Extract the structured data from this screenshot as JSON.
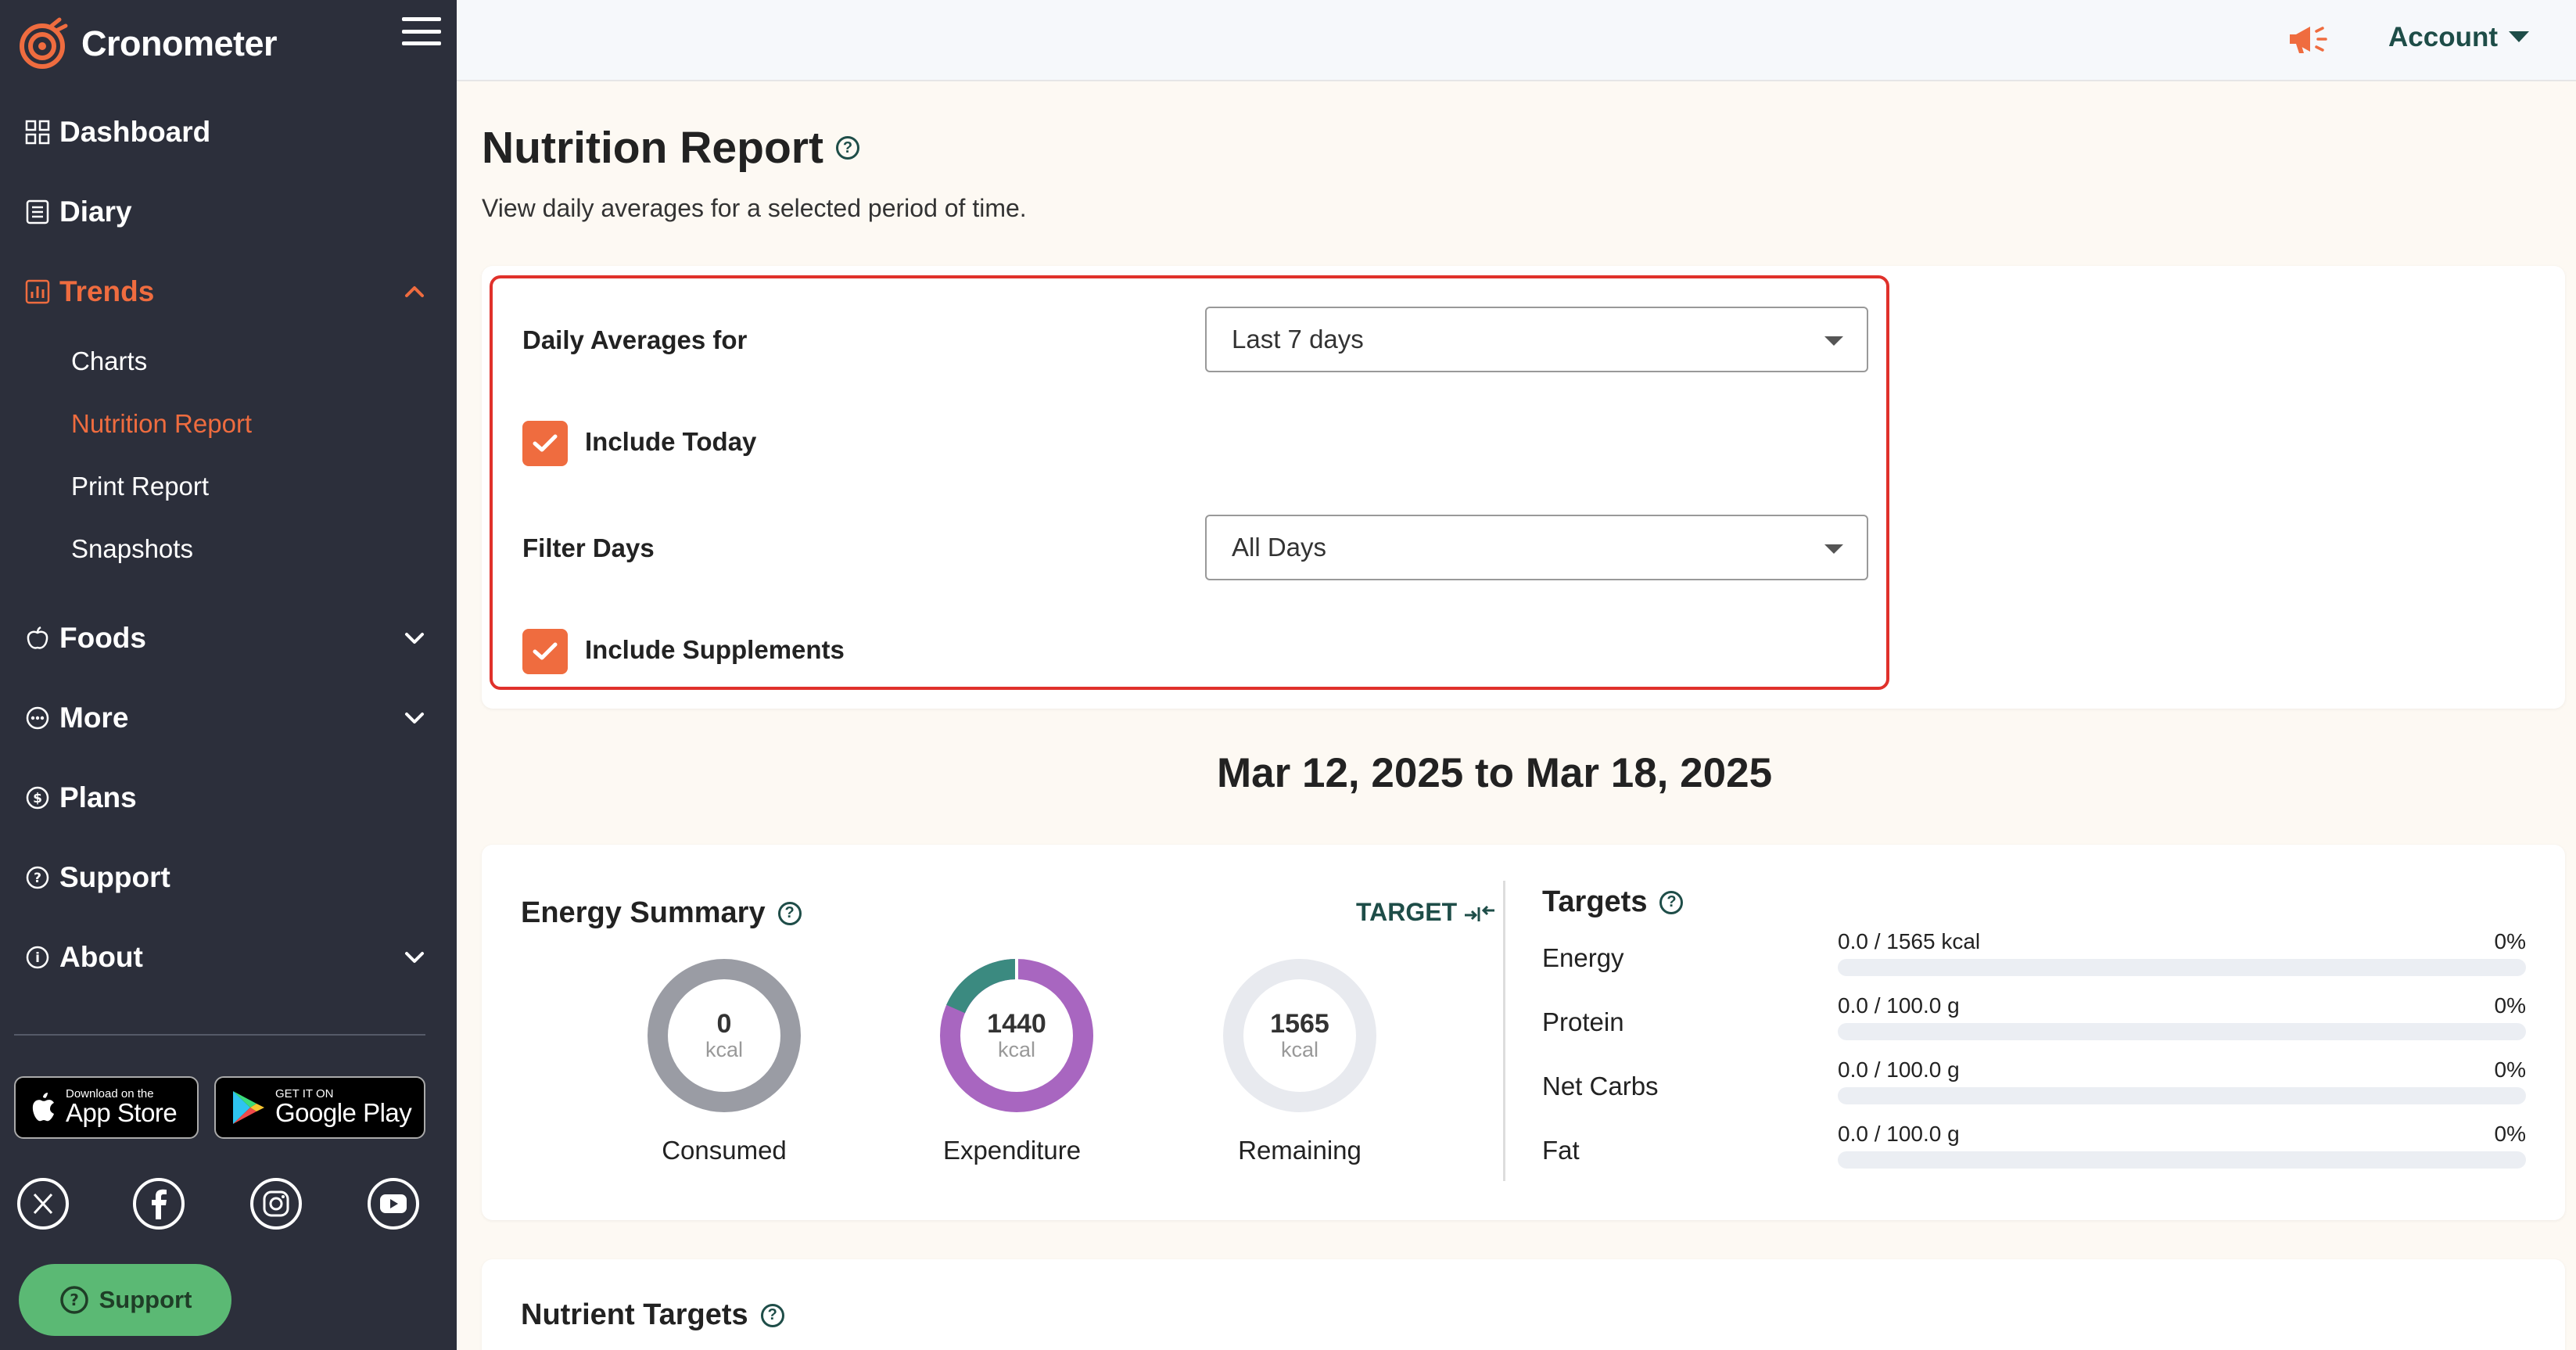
{
  "app": {
    "name": "Cronometer"
  },
  "sidebar": {
    "items": [
      {
        "label": "Dashboard",
        "icon": "grid-icon"
      },
      {
        "label": "Diary",
        "icon": "list-icon"
      },
      {
        "label": "Trends",
        "icon": "chart-icon",
        "expanded": true
      },
      {
        "label": "Foods",
        "icon": "apple-icon"
      },
      {
        "label": "More",
        "icon": "dots-icon"
      },
      {
        "label": "Plans",
        "icon": "dollar-icon"
      },
      {
        "label": "Support",
        "icon": "question-icon"
      },
      {
        "label": "About",
        "icon": "info-icon"
      }
    ],
    "trends_sub": [
      "Charts",
      "Nutrition Report",
      "Print Report",
      "Snapshots"
    ],
    "active_sub": "Nutrition Report",
    "app_store": {
      "small": "Download on the",
      "big": "App Store"
    },
    "google_play": {
      "small": "GET IT ON",
      "big": "Google Play"
    },
    "social": [
      "x-icon",
      "facebook-icon",
      "instagram-icon",
      "youtube-icon"
    ],
    "support_button": "Support"
  },
  "topbar": {
    "account_label": "Account"
  },
  "page": {
    "title": "Nutrition Report",
    "subtitle": "View daily averages for a selected period of time."
  },
  "filters": {
    "daily_averages_label": "Daily Averages for",
    "daily_averages_value": "Last 7 days",
    "include_today_label": "Include Today",
    "include_today": true,
    "filter_days_label": "Filter Days",
    "filter_days_value": "All Days",
    "include_supplements_label": "Include Supplements",
    "include_supplements": true
  },
  "date_range": "Mar 12, 2025 to Mar 18, 2025",
  "energy_summary": {
    "title": "Energy Summary",
    "target_link": "TARGET",
    "rings": [
      {
        "value": "0",
        "unit": "kcal",
        "label": "Consumed"
      },
      {
        "value": "1440",
        "unit": "kcal",
        "label": "Expenditure"
      },
      {
        "value": "1565",
        "unit": "kcal",
        "label": "Remaining"
      }
    ]
  },
  "targets": {
    "title": "Targets",
    "rows": [
      {
        "name": "Energy",
        "value": "0.0 / 1565 kcal",
        "percent": "0%",
        "fill": 0
      },
      {
        "name": "Protein",
        "value": "0.0 / 100.0 g",
        "percent": "0%",
        "fill": 0
      },
      {
        "name": "Net Carbs",
        "value": "0.0 / 100.0 g",
        "percent": "0%",
        "fill": 0
      },
      {
        "name": "Fat",
        "value": "0.0 / 100.0 g",
        "percent": "0%",
        "fill": 0
      }
    ]
  },
  "nutrient_targets": {
    "title": "Nutrient Targets"
  },
  "colors": {
    "sidebar_bg": "#2c2f3b",
    "accent_orange": "#ef6c3f",
    "teal_dark": "#1e4d48",
    "ring_purple": "#a866c0",
    "ring_teal": "#3b8a80",
    "ring_grey": "#9a9ca4",
    "highlight_red": "#e0312b",
    "support_green": "#5bb974"
  }
}
